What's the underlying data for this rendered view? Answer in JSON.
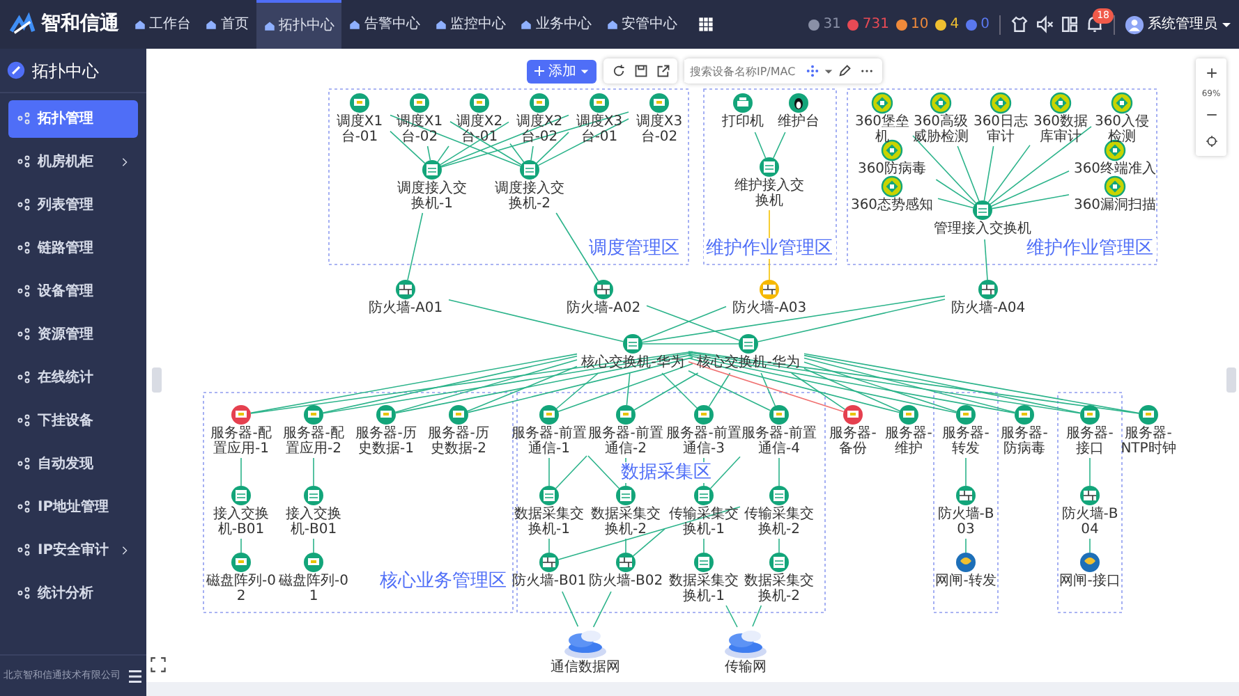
{
  "topbar": {
    "logo": "智和信通",
    "tabs": [
      {
        "label": "工作台",
        "selected": false
      },
      {
        "label": "首页",
        "selected": false
      },
      {
        "label": "拓扑中心",
        "selected": true
      },
      {
        "label": "告警中心",
        "selected": false
      },
      {
        "label": "监控中心",
        "selected": false
      },
      {
        "label": "业务中心",
        "selected": false
      },
      {
        "label": "安管中心",
        "selected": false
      }
    ],
    "alarms": [
      {
        "count": "31",
        "color": "#8a90a6"
      },
      {
        "count": "731",
        "color": "#e84a55"
      },
      {
        "count": "10",
        "color": "#f08a3a"
      },
      {
        "count": "4",
        "color": "#f0c030"
      },
      {
        "count": "0",
        "color": "#5a78f0"
      }
    ],
    "notification_badge": "18",
    "user": "系统管理员"
  },
  "sidebar": {
    "title": "拓扑中心",
    "items": [
      {
        "label": "拓扑管理",
        "selected": true,
        "submenu": false
      },
      {
        "label": "机房机柜",
        "selected": false,
        "submenu": true
      },
      {
        "label": "列表管理",
        "selected": false,
        "submenu": false
      },
      {
        "label": "链路管理",
        "selected": false,
        "submenu": false
      },
      {
        "label": "设备管理",
        "selected": false,
        "submenu": false
      },
      {
        "label": "资源管理",
        "selected": false,
        "submenu": false
      },
      {
        "label": "在线统计",
        "selected": false,
        "submenu": false
      },
      {
        "label": "下挂设备",
        "selected": false,
        "submenu": false
      },
      {
        "label": "自动发现",
        "selected": false,
        "submenu": false
      },
      {
        "label": "IP地址管理",
        "selected": false,
        "submenu": false
      },
      {
        "label": "IP安全审计",
        "selected": false,
        "submenu": true
      },
      {
        "label": "统计分析",
        "selected": false,
        "submenu": false
      }
    ],
    "footer": "北京智和信通技术有限公司"
  },
  "toolbar": {
    "add_button": "添加",
    "search": {
      "placeholder": "搜索设备名称IP/MAC"
    }
  },
  "zoom": {
    "value": "69%"
  },
  "diagram": {
    "zones": [
      {
        "title": "调度管理区"
      },
      {
        "title": "维护作业管理区"
      },
      {
        "title": "维护作业管理区"
      },
      {
        "title": "核心业务管理区"
      },
      {
        "title": "数据采集区"
      }
    ],
    "nodes": [
      {
        "label": "调度X1台-01",
        "kind": "terminal",
        "color": "#13a57a"
      },
      {
        "label": "调度X1台-02",
        "kind": "terminal",
        "color": "#13a57a"
      },
      {
        "label": "调度X2台-01",
        "kind": "terminal",
        "color": "#13a57a"
      },
      {
        "label": "调度X2台-02",
        "kind": "terminal",
        "color": "#13a57a"
      },
      {
        "label": "调度X3台-01",
        "kind": "terminal",
        "color": "#13a57a"
      },
      {
        "label": "调度X3台-02",
        "kind": "terminal",
        "color": "#13a57a"
      },
      {
        "label": "调度接入交换机-1",
        "kind": "switch",
        "color": "#13a57a"
      },
      {
        "label": "调度接入交换机-2",
        "kind": "switch",
        "color": "#13a57a"
      },
      {
        "label": "打印机",
        "kind": "printer",
        "color": "#13a57a"
      },
      {
        "label": "维护台",
        "kind": "linux",
        "color": "#13a57a"
      },
      {
        "label": "维护接入交换机",
        "kind": "switch",
        "color": "#13a57a"
      },
      {
        "label": "360堡垒机",
        "kind": "security",
        "color": "#c8d400"
      },
      {
        "label": "360高级威胁检测",
        "kind": "security",
        "color": "#c8d400"
      },
      {
        "label": "360日志审计",
        "kind": "security",
        "color": "#c8d400"
      },
      {
        "label": "360数据库审计",
        "kind": "security",
        "color": "#c8d400"
      },
      {
        "label": "360入侵检测",
        "kind": "security",
        "color": "#c8d400"
      },
      {
        "label": "360防病毒",
        "kind": "security",
        "color": "#c8d400"
      },
      {
        "label": "360终端准入",
        "kind": "security",
        "color": "#c8d400"
      },
      {
        "label": "360态势感知",
        "kind": "security",
        "color": "#c8d400"
      },
      {
        "label": "360漏洞扫描",
        "kind": "security",
        "color": "#c8d400"
      },
      {
        "label": "管理接入交换机",
        "kind": "switch",
        "color": "#13a57a"
      },
      {
        "label": "防火墙-A01",
        "kind": "firewall",
        "color": "#13a57a"
      },
      {
        "label": "防火墙-A02",
        "kind": "firewall",
        "color": "#13a57a"
      },
      {
        "label": "防火墙-A03",
        "kind": "firewall",
        "color": "#f5b800"
      },
      {
        "label": "防火墙-A04",
        "kind": "firewall",
        "color": "#13a57a"
      },
      {
        "label": "核心交换机-华为",
        "kind": "switch",
        "color": "#13a57a"
      },
      {
        "label": "核心交换机-华为",
        "kind": "switch",
        "color": "#13a57a"
      },
      {
        "label": "服务器-配置应用-1",
        "kind": "server",
        "color": "#e5404f"
      },
      {
        "label": "服务器-配置应用-2",
        "kind": "server",
        "color": "#13a57a"
      },
      {
        "label": "服务器-历史数据-1",
        "kind": "server",
        "color": "#13a57a"
      },
      {
        "label": "服务器-历史数据-2",
        "kind": "server",
        "color": "#13a57a"
      },
      {
        "label": "服务器-前置通信-1",
        "kind": "server",
        "color": "#13a57a"
      },
      {
        "label": "服务器-前置通信-2",
        "kind": "server",
        "color": "#13a57a"
      },
      {
        "label": "服务器-前置通信-3",
        "kind": "server",
        "color": "#13a57a"
      },
      {
        "label": "服务器-前置通信-4",
        "kind": "server",
        "color": "#13a57a"
      },
      {
        "label": "服务器-备份",
        "kind": "server",
        "color": "#e5404f"
      },
      {
        "label": "服务器-维护",
        "kind": "server",
        "color": "#13a57a"
      },
      {
        "label": "服务器-转发",
        "kind": "server",
        "color": "#13a57a"
      },
      {
        "label": "服务器-防病毒",
        "kind": "server",
        "color": "#13a57a"
      },
      {
        "label": "服务器-接口",
        "kind": "server",
        "color": "#13a57a"
      },
      {
        "label": "服务器-NTP时钟",
        "kind": "server",
        "color": "#13a57a"
      },
      {
        "label": "接入交换机-B01",
        "kind": "switch",
        "color": "#13a57a"
      },
      {
        "label": "接入交换机-B01",
        "kind": "switch",
        "color": "#13a57a"
      },
      {
        "label": "数据采集交换机-1",
        "kind": "switch",
        "color": "#13a57a"
      },
      {
        "label": "数据采集交换机-2",
        "kind": "switch",
        "color": "#13a57a"
      },
      {
        "label": "传输采集交换机-1",
        "kind": "switch",
        "color": "#13a57a"
      },
      {
        "label": "传输采集交换机-2",
        "kind": "switch",
        "color": "#13a57a"
      },
      {
        "label": "防火墙-B03",
        "kind": "firewall",
        "color": "#13a57a"
      },
      {
        "label": "防火墙-B04",
        "kind": "firewall",
        "color": "#13a57a"
      },
      {
        "label": "磁盘阵列-02",
        "kind": "storage",
        "color": "#13a57a"
      },
      {
        "label": "磁盘阵列-01",
        "kind": "storage",
        "color": "#13a57a"
      },
      {
        "label": "防火墙-B01",
        "kind": "firewall",
        "color": "#13a57a"
      },
      {
        "label": "防火墙-B02",
        "kind": "firewall",
        "color": "#13a57a"
      },
      {
        "label": "数据采集交换机-1",
        "kind": "switch",
        "color": "#13a57a"
      },
      {
        "label": "数据采集交换机-2",
        "kind": "switch",
        "color": "#13a57a"
      },
      {
        "label": "网闸-转发",
        "kind": "gateway",
        "color": "#1d6fb8"
      },
      {
        "label": "网闸-接口",
        "kind": "gateway",
        "color": "#1d6fb8"
      },
      {
        "label": "通信数据网",
        "kind": "cloud"
      },
      {
        "label": "传输网",
        "kind": "cloud"
      }
    ]
  }
}
